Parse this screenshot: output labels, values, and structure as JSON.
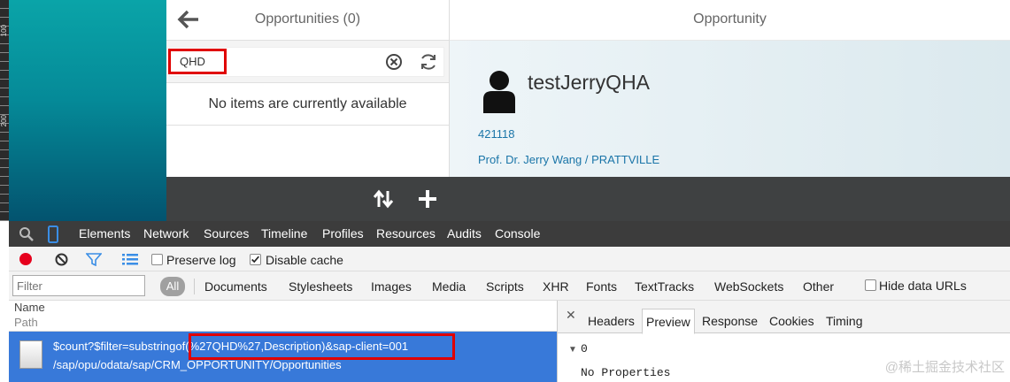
{
  "ruler": {
    "labels": [
      "100",
      "200"
    ]
  },
  "master": {
    "title": "Opportunities (0)",
    "search_value": "QHD",
    "empty_message": "No items are currently available"
  },
  "detail": {
    "header_title": "Opportunity",
    "name": "testJerryQHA",
    "id": "421118",
    "subtitle": "Prof. Dr. Jerry Wang / PRATTVILLE"
  },
  "devtools": {
    "tabs": [
      "Elements",
      "Network",
      "Sources",
      "Timeline",
      "Profiles",
      "Resources",
      "Audits",
      "Console"
    ],
    "preserve_log_label": "Preserve log",
    "preserve_log_checked": false,
    "disable_cache_label": "Disable cache",
    "disable_cache_checked": true,
    "filter_placeholder": "Filter",
    "all_label": "All",
    "type_filters": [
      "Documents",
      "Stylesheets",
      "Images",
      "Media",
      "Scripts",
      "XHR",
      "Fonts",
      "TextTracks",
      "WebSockets",
      "Other"
    ],
    "hide_data_urls_label": "Hide data URLs",
    "hide_data_urls_checked": false,
    "columns": {
      "name": "Name",
      "path": "Path"
    },
    "request": {
      "name": "$count?$filter=substringof(%27QHD%27,Description)&sap-client=001",
      "path": "/sap/opu/odata/sap/CRM_OPPORTUNITY/Opportunities"
    },
    "detail_tabs": [
      "Headers",
      "Preview",
      "Response",
      "Cookies",
      "Timing"
    ],
    "active_detail_tab": "Preview",
    "preview_root": "0",
    "preview_empty": "No Properties"
  },
  "watermark": "@稀土掘金技术社区",
  "colors": {
    "selection_blue": "#3879d9",
    "highlight_red": "#e00000",
    "record_red": "#e6001d",
    "link_blue": "#1a75a8"
  }
}
